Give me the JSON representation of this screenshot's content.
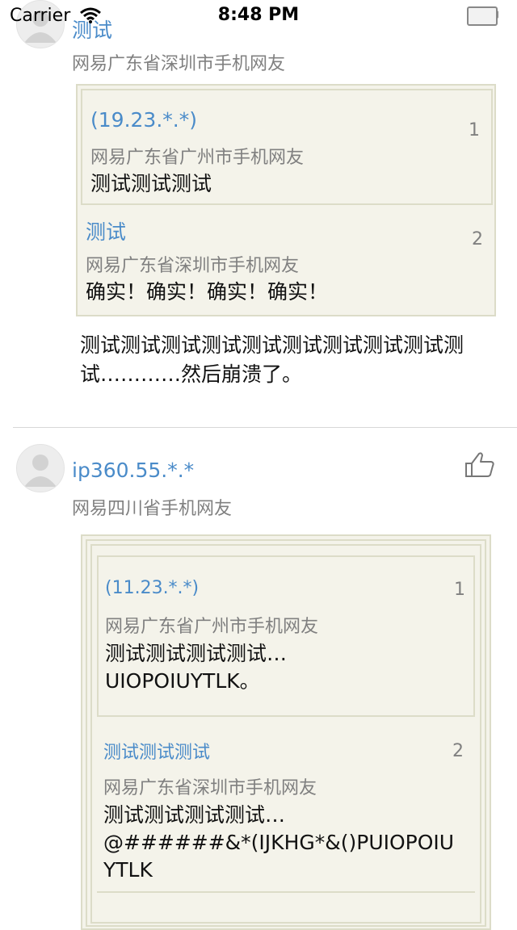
{
  "status_bar": {
    "carrier": "Carrier",
    "time": "8:48 PM"
  },
  "comments": [
    {
      "user": "测试",
      "source": "网易广东省深圳市手机网友",
      "floors": [
        {
          "name": "(19.23.*.*)",
          "source": "网易广东省广州市手机网友",
          "number": "1",
          "text": "测试测试测试"
        },
        {
          "name": "测试",
          "source": "网易广东省深圳市手机网友",
          "number": "2",
          "text": "确实！确实！确实！确实！"
        }
      ],
      "body_line1": "测试测试测试测试测试测试测试测试测试测",
      "body_line2": "试…………然后崩溃了。"
    },
    {
      "user": "ip360.55.*.*",
      "source": "网易四川省手机网友",
      "floors": [
        {
          "name": "(11.23.*.*)",
          "source": "网易广东省广州市手机网友",
          "number": "1",
          "text_line1": "测试测试测试测试…",
          "text_line2": "UIOPOIUYTLK。"
        },
        {
          "name": "测试测试测试",
          "source": "网易广东省深圳市手机网友",
          "number": "2",
          "text_line1": "测试测试测试测试…",
          "text_line2": "@######&*(IJKHG*&()PUIOPOIU",
          "text_line3": "YTLK"
        }
      ]
    }
  ]
}
